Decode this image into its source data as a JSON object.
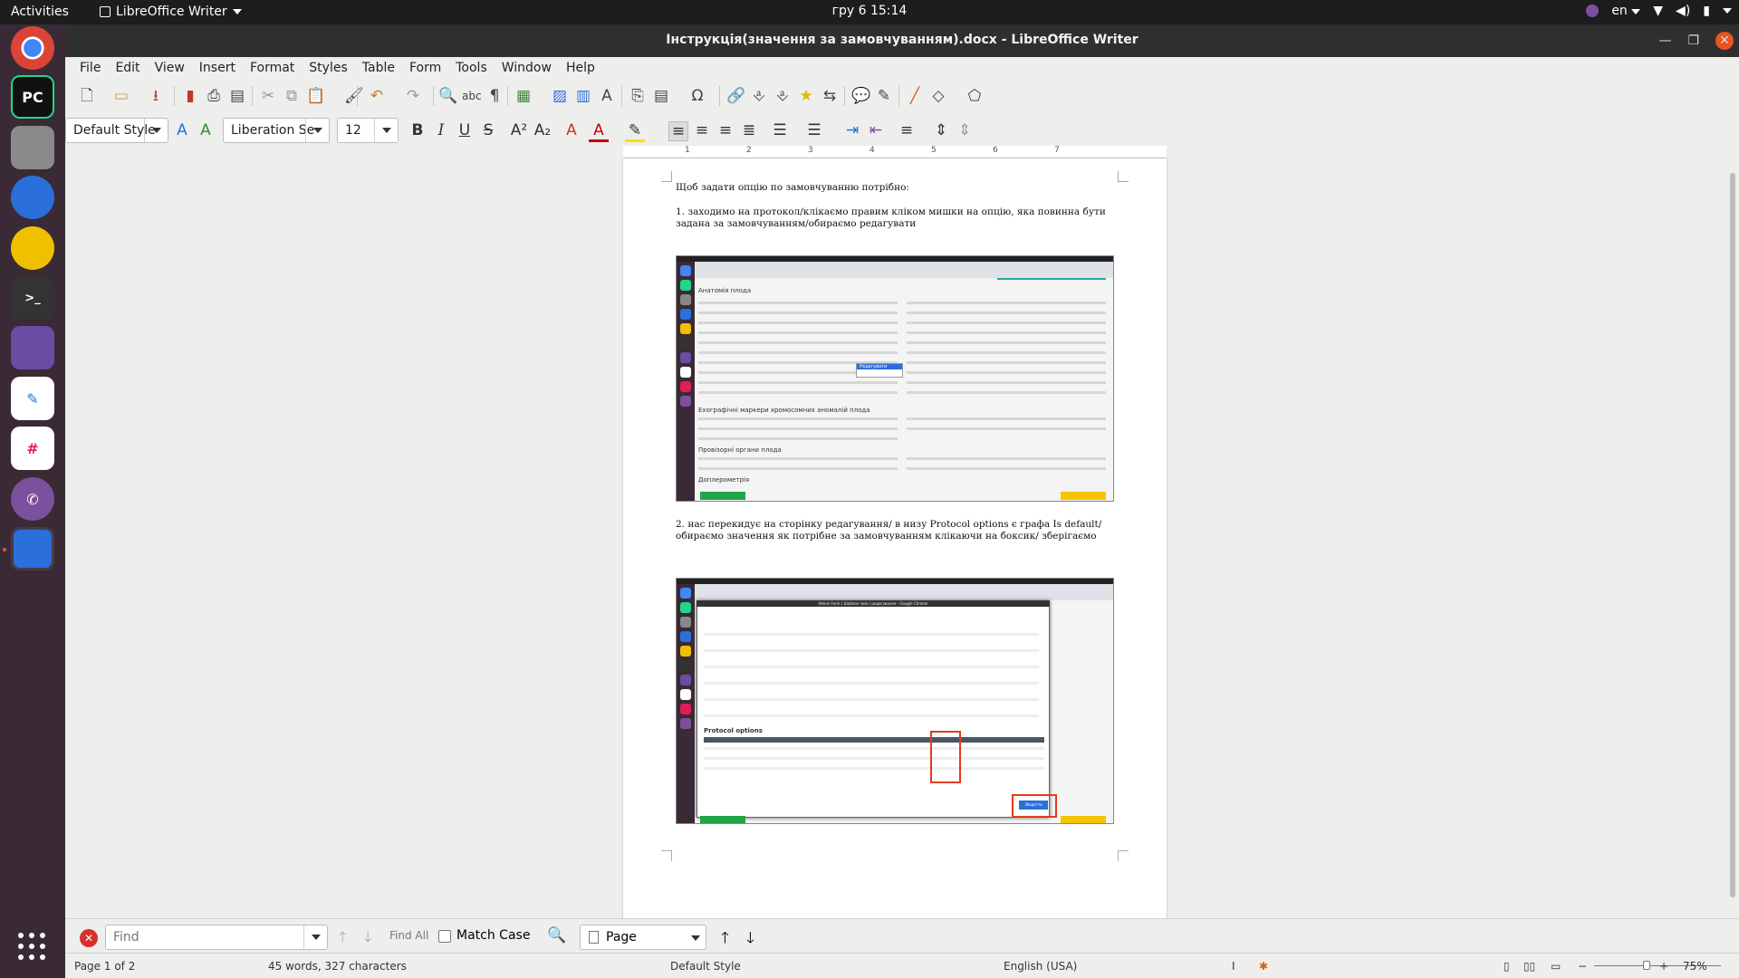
{
  "topbar": {
    "activities": "Activities",
    "app_name": "LibreOffice Writer",
    "clock": "гру 6  15:14",
    "lang": "en"
  },
  "window": {
    "title": "Інструкція(значення за замовчуванням).docx - LibreOffice Writer"
  },
  "menu": [
    "File",
    "Edit",
    "View",
    "Insert",
    "Format",
    "Styles",
    "Table",
    "Form",
    "Tools",
    "Window",
    "Help"
  ],
  "formatting": {
    "paragraph_style": "Default Style",
    "font_name": "Liberation Se",
    "font_size": "12"
  },
  "document": {
    "para1": "Щоб задати опцію по замовчуванню потрібно:",
    "para2": "1. заходимо на протокол/клікаємо правим кліком мишки на опцію, яка повинна бути задана за замовчуванням/обираємо редагувати",
    "para3": "2. нас перекидує на сторінку редагування/ в низу Protocol options є графа Is default/обираємо значення як потрібне за замовчуванням клікаючи на боксик/ зберігаємо",
    "shot1": {
      "section1": "Анатомія плода",
      "section2": "Ехографічні маркери хромосомних аномалій плода",
      "section3": "Провізорні органи плода",
      "section4": "Доплерометрія",
      "menu_edit": "Редагувати"
    },
    "shot2": {
      "header": "Protocol options",
      "modal_title": "Admin Form | Шаблон змін / редагування - Google Chrome",
      "save": "Зберегти"
    }
  },
  "findbar": {
    "placeholder": "Find",
    "find_all": "Find All",
    "match_case": "Match Case",
    "search_by": "Page"
  },
  "status": {
    "page": "Page 1 of 2",
    "words": "45 words, 327 characters",
    "style": "Default Style",
    "language": "English (USA)",
    "zoom": "75%"
  }
}
